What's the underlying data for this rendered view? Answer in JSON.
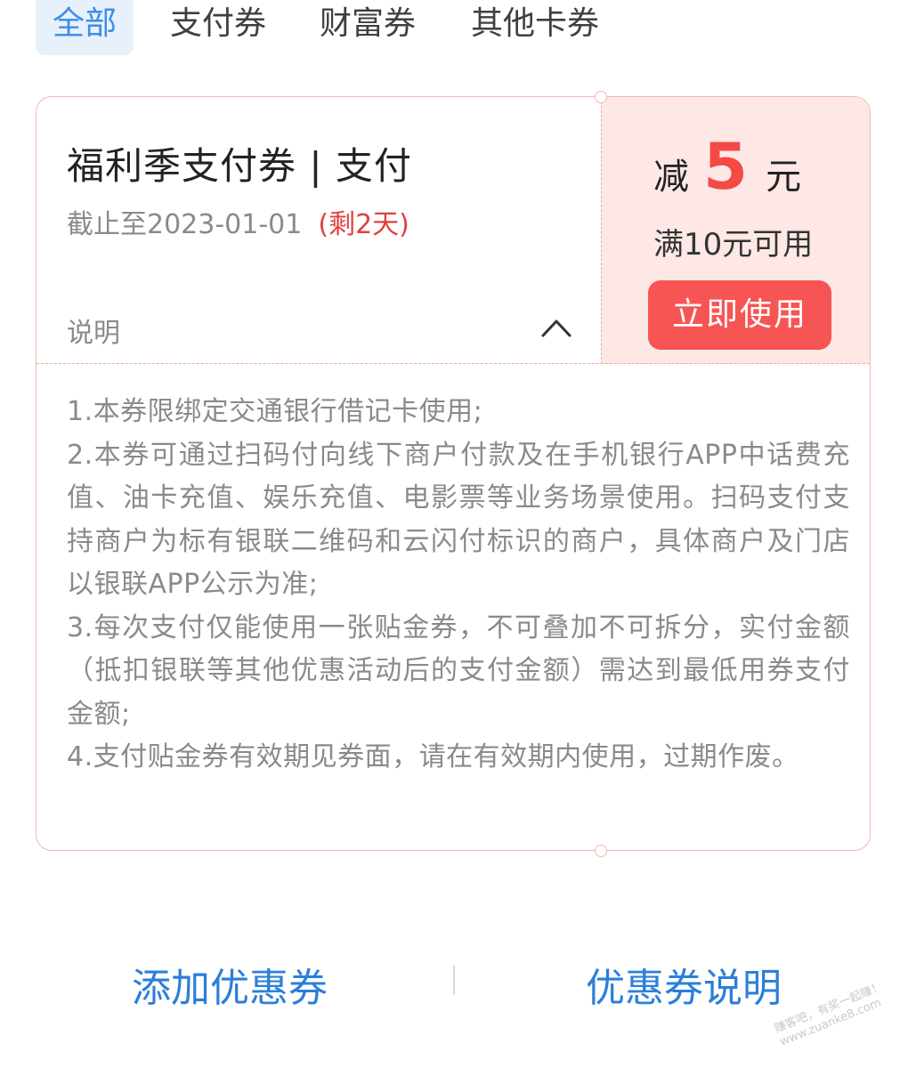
{
  "tabs": [
    {
      "label": "全部",
      "active": true
    },
    {
      "label": "支付券",
      "active": false
    },
    {
      "label": "财富券",
      "active": false
    },
    {
      "label": "其他卡券",
      "active": false
    }
  ],
  "coupon": {
    "title": "福利季支付券 | 支付",
    "expiry": "截止至2023-01-01",
    "remaining": "(剩2天)",
    "explain_label": "说明",
    "chevron_icon": "chevron-up-icon",
    "discount_prefix": "减",
    "discount_amount": "5",
    "discount_unit": "元",
    "condition": "满10元可用",
    "use_button": "立即使用",
    "rules": [
      "1.本券限绑定交通银行借记卡使用;",
      "2.本券可通过扫码付向线下商户付款及在手机银行APP中话费充值、油卡充值、娱乐充值、电影票等业务场景使用。扫码支付支持商户为标有银联二维码和云闪付标识的商户，具体商户及门店以银联APP公示为准;",
      "3.每次支付仅能使用一张贴金券，不可叠加不可拆分，实付金额（抵扣银联等其他优惠活动后的支付金额）需达到最低用券支付金额;",
      "4.支付贴金券有效期见券面，请在有效期内使用，过期作废。"
    ]
  },
  "actions": {
    "add_coupon": "添加优惠券",
    "coupon_info": "优惠券说明"
  },
  "watermark": {
    "line1": "赚客吧，有奖一起赚！",
    "line2": "www.zuanke8.com"
  },
  "colors": {
    "accent_blue": "#3b8ee8",
    "action_blue": "#2b7fd8",
    "red": "#f44a45",
    "button_red": "#f65554",
    "panel_pink": "#fde8e6"
  }
}
